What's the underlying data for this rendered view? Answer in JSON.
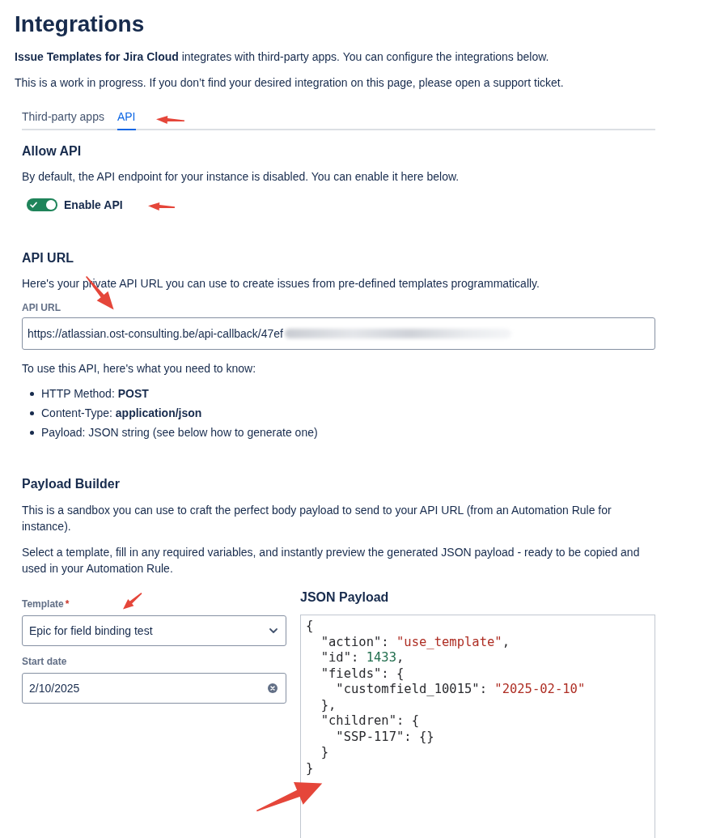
{
  "page": {
    "title": "Integrations",
    "intro": "**Issue Templates for Jira Cloud** integrates with third-party apps. You can configure the integrations below.",
    "note": "This is a work in progress. If you don’t find your desired integration on this page, please open a support ticket."
  },
  "tabs": [
    {
      "label": "Third-party apps",
      "selected": false
    },
    {
      "label": "API",
      "selected": true
    }
  ],
  "allow_api": {
    "heading": "Allow API",
    "description": "By default, the API endpoint for your instance is disabled. You can enable it here below.",
    "toggle": {
      "label": "Enable API",
      "on": true
    }
  },
  "api_url": {
    "heading": "API URL",
    "description": "Here's your private API URL you can use to create issues from pre-defined templates programmatically.",
    "field_label": "API URL",
    "value": "https://atlassian.ost-consulting.be/api-callback/47ef",
    "redacted": true,
    "intro": "To use this API, here's what you need to know:",
    "requirements": [
      "HTTP Method: **POST**",
      "Content-Type: **application/json**",
      "Payload: JSON string (see below how to generate one)"
    ]
  },
  "payload_builder": {
    "heading": "Payload Builder",
    "descriptions": [
      "This is a sandbox you can use to craft the perfect body payload to send to your API URL (from an Automation Rule for instance).",
      "Select a template, fill in any required variables, and instantly preview the generated JSON payload - ready to be copied and used in your Automation Rule."
    ],
    "template": {
      "label": "Template",
      "required_mark": "*",
      "value": "Epic for field binding test"
    },
    "start_date": {
      "label": "Start date",
      "value": "2/10/2025"
    },
    "json_payload": {
      "heading": "JSON Payload",
      "lines": [
        [
          {
            "text": "{",
            "kind": "punct"
          }
        ],
        [
          {
            "text": "  \"action\": ",
            "kind": "key"
          },
          {
            "text": "\"use_template\"",
            "kind": "string"
          },
          {
            "text": ",",
            "kind": "punct"
          }
        ],
        [
          {
            "text": "  \"id\": ",
            "kind": "key"
          },
          {
            "text": "1433",
            "kind": "number"
          },
          {
            "text": ",",
            "kind": "punct"
          }
        ],
        [
          {
            "text": "  \"fields\": {",
            "kind": "key"
          }
        ],
        [
          {
            "text": "    \"customfield_10015\": ",
            "kind": "key"
          },
          {
            "text": "\"2025-02-10\"",
            "kind": "string"
          }
        ],
        [
          {
            "text": "  },",
            "kind": "punct"
          }
        ],
        [
          {
            "text": "  \"children\": {",
            "kind": "key"
          }
        ],
        [
          {
            "text": "    \"SSP-117\": {}",
            "kind": "key"
          }
        ],
        [
          {
            "text": "  }",
            "kind": "punct"
          }
        ],
        [
          {
            "text": "}",
            "kind": "punct"
          }
        ]
      ]
    }
  }
}
